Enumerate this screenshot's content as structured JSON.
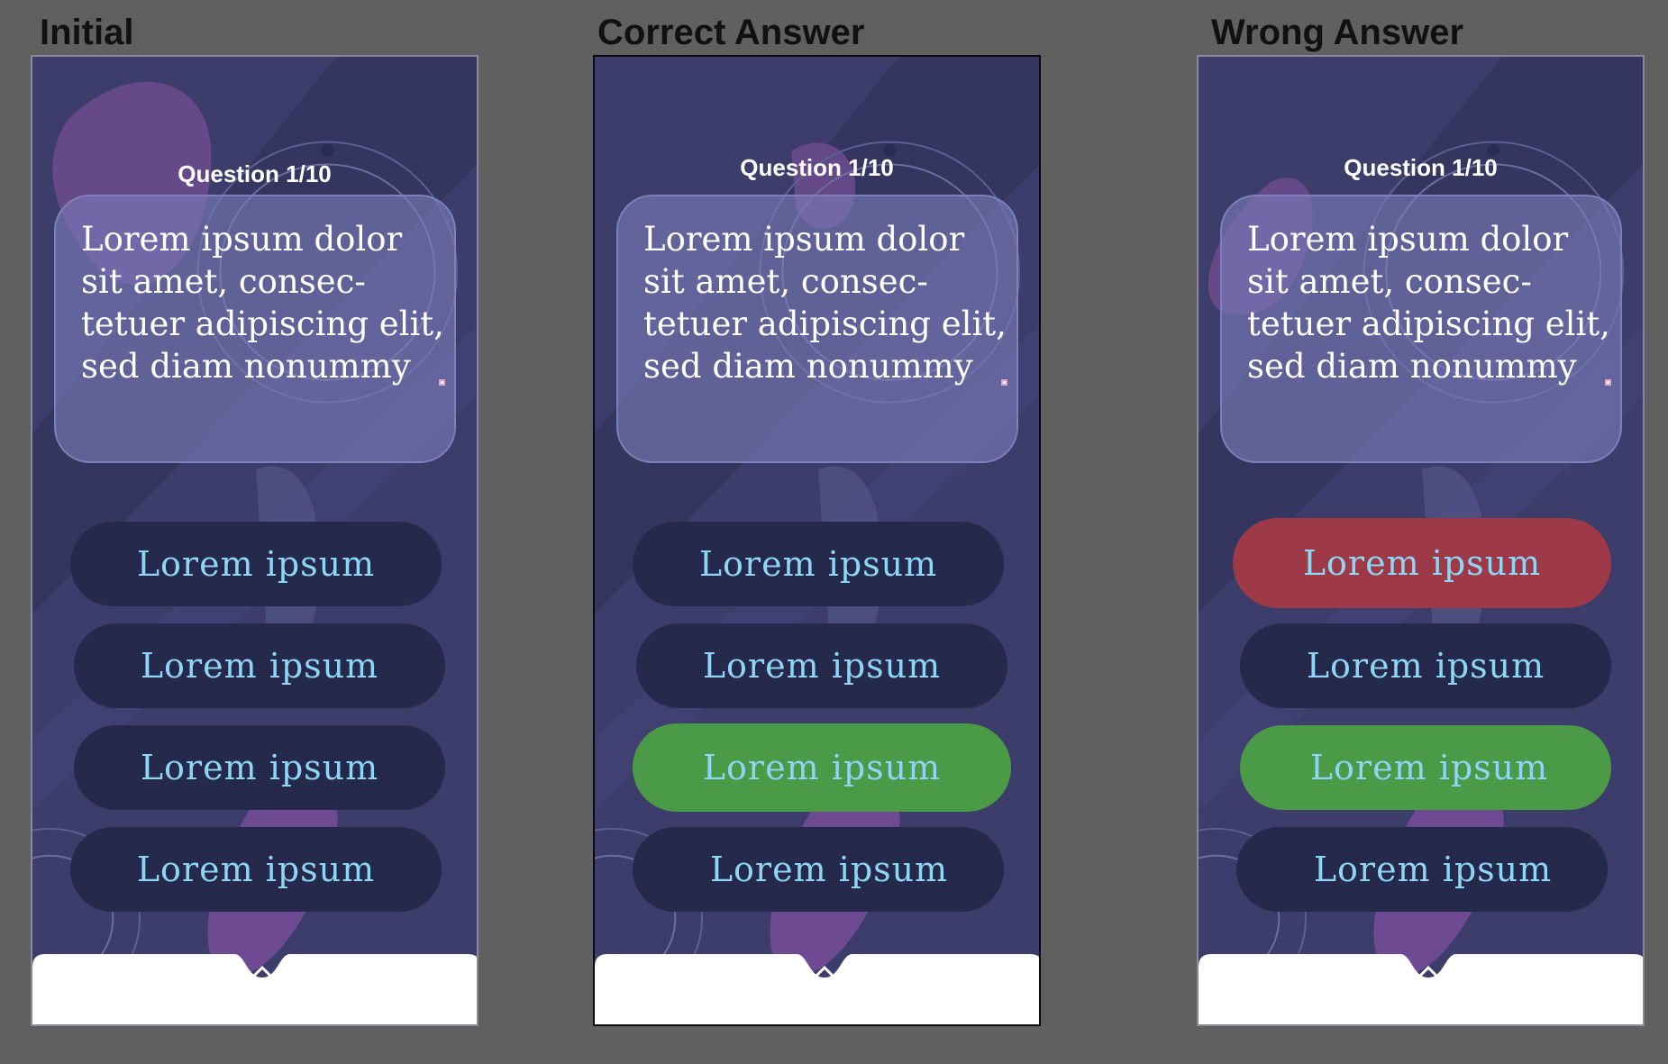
{
  "colors": {
    "page_background": "#606060",
    "screen_background": "#3c3d6a",
    "card": "#7a7cba",
    "answer_default": "#252a4d",
    "answer_correct": "#4a9a47",
    "answer_wrong": "#9e3a48",
    "answer_text": "#8fd6f6"
  },
  "panels": [
    {
      "title": "Initial",
      "question_label": "Question 1/10",
      "question_text": "Lorem ipsum dolor\nsit amet, consec-\ntetuer adipiscing elit,\nsed diam nonummy",
      "answers": [
        {
          "label": "Lorem ipsum",
          "state": "default"
        },
        {
          "label": "Lorem ipsum",
          "state": "default"
        },
        {
          "label": "Lorem ipsum",
          "state": "default"
        },
        {
          "label": "Lorem ipsum",
          "state": "default"
        }
      ],
      "expand_icon": "chevron-up-icon"
    },
    {
      "title": "Correct Answer",
      "question_label": "Question 1/10",
      "question_text": "Lorem ipsum dolor\nsit amet, consec-\ntetuer adipiscing elit,\nsed diam nonummy",
      "answers": [
        {
          "label": "Lorem ipsum",
          "state": "default"
        },
        {
          "label": "Lorem ipsum",
          "state": "default"
        },
        {
          "label": "Lorem ipsum",
          "state": "correct"
        },
        {
          "label": "Lorem ipsum",
          "state": "default"
        }
      ],
      "expand_icon": "chevron-up-icon"
    },
    {
      "title": "Wrong Answer",
      "question_label": "Question 1/10",
      "question_text": "Lorem ipsum dolor\nsit amet, consec-\ntetuer adipiscing elit,\nsed diam nonummy",
      "answers": [
        {
          "label": "Lorem ipsum",
          "state": "wrong"
        },
        {
          "label": "Lorem ipsum",
          "state": "default"
        },
        {
          "label": "Lorem ipsum",
          "state": "correct"
        },
        {
          "label": "Lorem ipsum",
          "state": "default"
        }
      ],
      "expand_icon": "chevron-up-icon"
    }
  ]
}
